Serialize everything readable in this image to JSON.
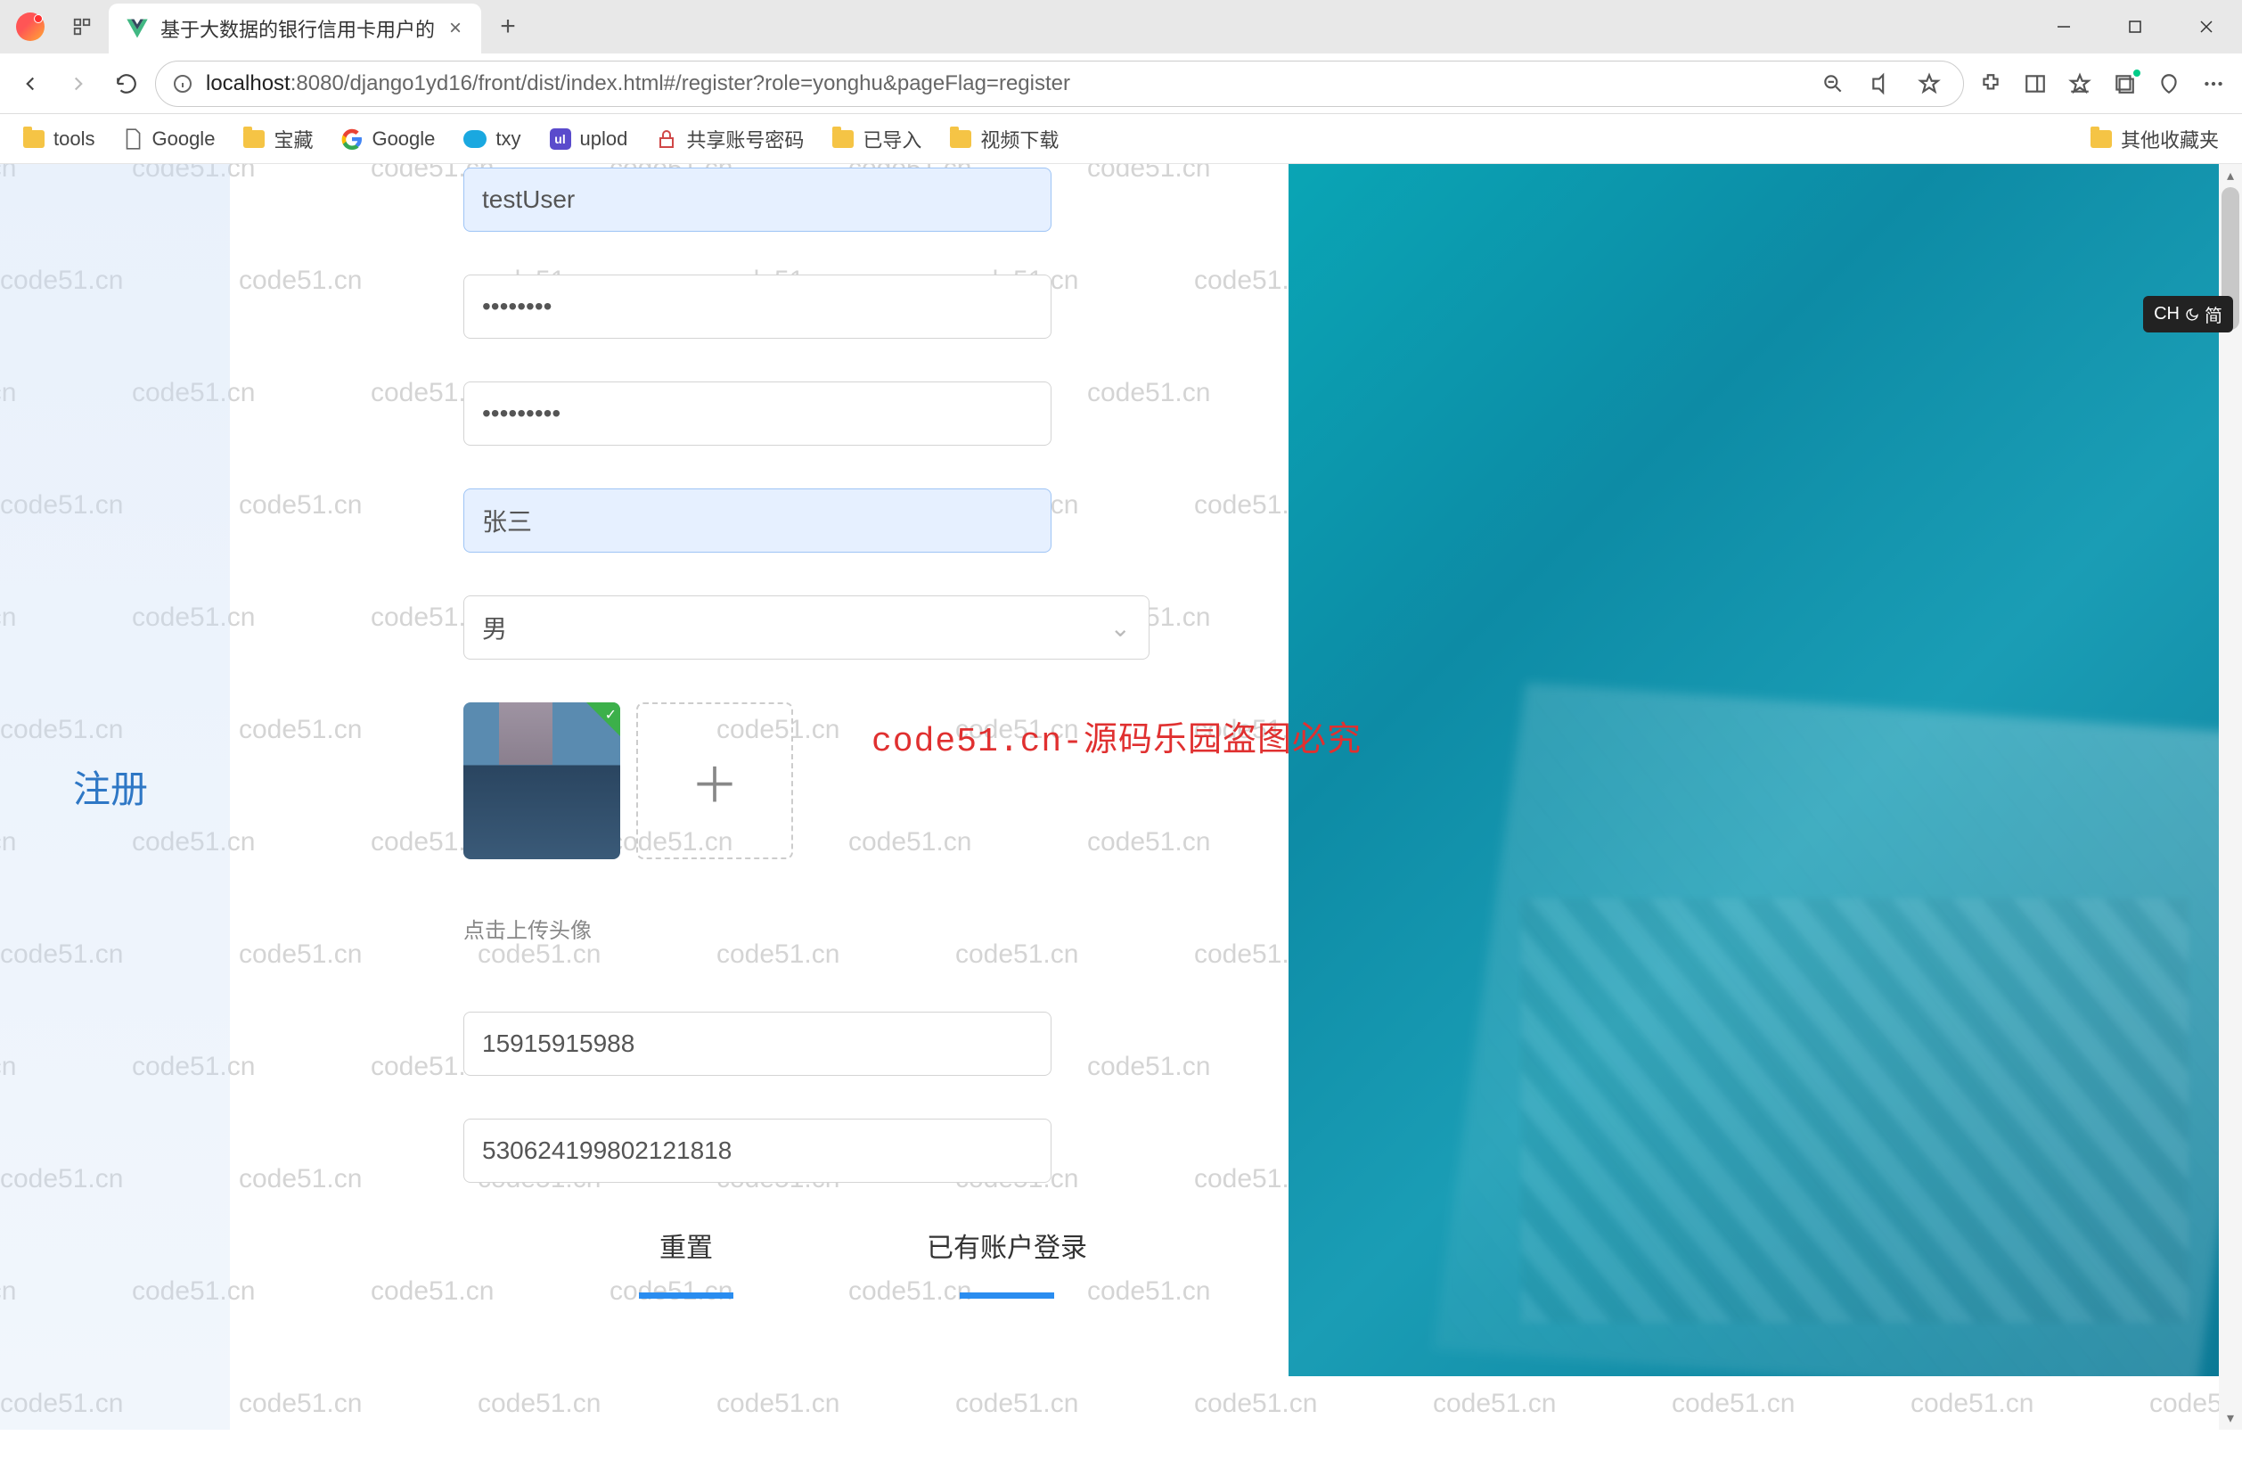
{
  "watermark_text": "code51.cn",
  "browser": {
    "tab_title": "基于大数据的银行信用卡用户的",
    "url_host": "localhost",
    "url_path": ":8080/django1yd16/front/dist/index.html#/register?role=yonghu&pageFlag=register",
    "bookmarks": [
      "tools",
      "Google",
      "宝藏",
      "Google",
      "txy",
      "uplod",
      "共享账号密码",
      "已导入",
      "视频下载"
    ],
    "other_bookmarks": "其他收藏夹"
  },
  "ime": {
    "text": "CH",
    "mode": "简"
  },
  "page": {
    "heading": "注册",
    "form": {
      "username": "testUser",
      "password1": "••••••••",
      "password2": "•••••••••",
      "realname": "张三",
      "gender": "男",
      "upload_hint": "点击上传头像",
      "phone": "15915915988",
      "idcard": "530624199802121818"
    },
    "buttons": {
      "reset": "重置",
      "login_link": "已有账户登录"
    }
  },
  "overlay_text": "code51.cn-源码乐园盗图必究"
}
